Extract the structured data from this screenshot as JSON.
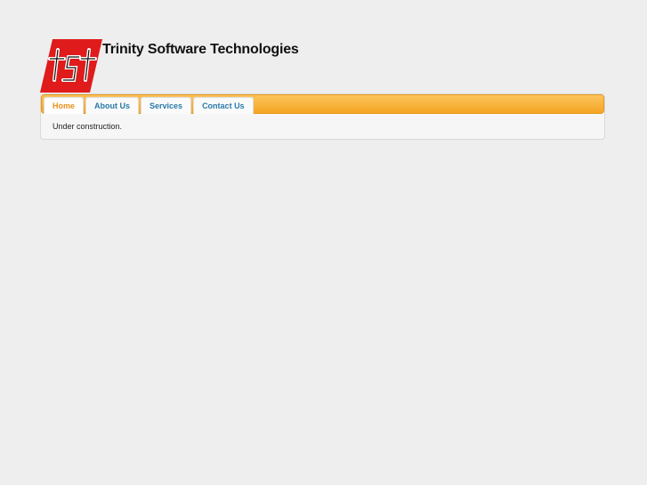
{
  "header": {
    "logo_text": "tst",
    "site_title": "Trinity Software Technologies"
  },
  "nav": {
    "tabs": [
      {
        "label": "Home",
        "active": true
      },
      {
        "label": "About Us",
        "active": false
      },
      {
        "label": "Services",
        "active": false
      },
      {
        "label": "Contact Us",
        "active": false
      }
    ]
  },
  "content": {
    "text": "Under construction."
  },
  "colors": {
    "background": "#eeeeee",
    "tabbar_orange": "#f5a623",
    "tab_link_blue": "#2a7aaa",
    "tab_active_orange": "#e8901a",
    "logo_red": "#e01b1b"
  }
}
